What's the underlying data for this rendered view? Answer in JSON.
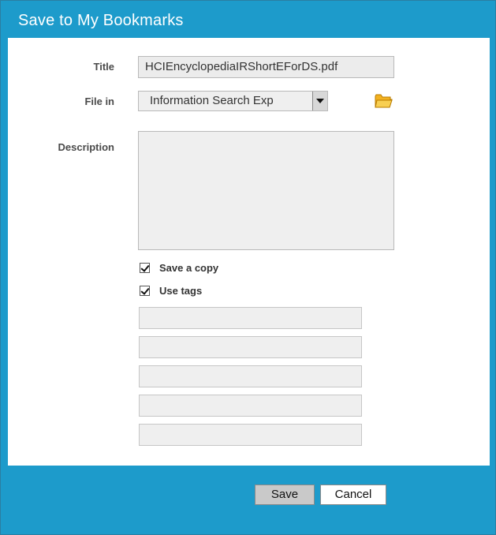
{
  "dialog": {
    "title": "Save to My Bookmarks"
  },
  "form": {
    "title_label": "Title",
    "title_value": "HCIEncyclopediaIRShortEForDS.pdf",
    "file_in_label": "File in",
    "file_in_value": "Information Search Exp",
    "description_label": "Description",
    "description_value": "",
    "save_copy_label": "Save a copy",
    "save_copy_checked": true,
    "use_tags_label": "Use tags",
    "use_tags_checked": true,
    "tags": [
      "",
      "",
      "",
      "",
      ""
    ]
  },
  "buttons": {
    "save_label": "Save",
    "cancel_label": "Cancel"
  },
  "colors": {
    "accent": "#1d9bcb",
    "folder_icon": "#f2b120"
  },
  "icons": {
    "folder": "folder-open-icon",
    "dropdown": "dropdown-arrow-icon",
    "checkbox": "checkbox-checked-icon"
  }
}
